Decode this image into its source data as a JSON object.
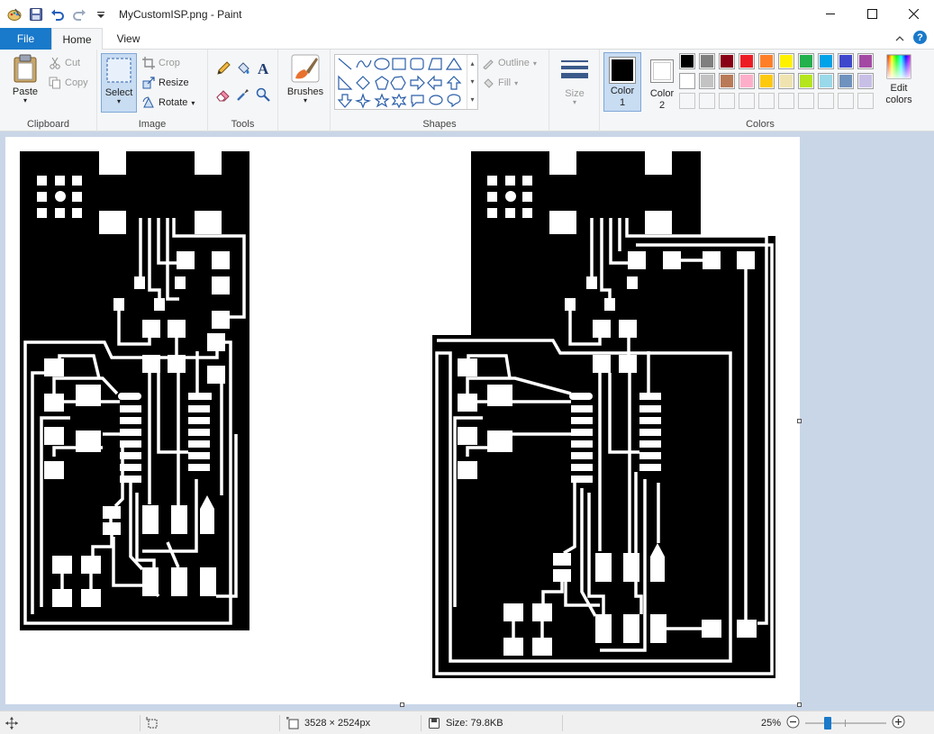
{
  "window": {
    "title": "MyCustomISP.png - Paint"
  },
  "tabs": {
    "file": "File",
    "home": "Home",
    "view": "View"
  },
  "clipboard": {
    "paste": "Paste",
    "cut": "Cut",
    "copy": "Copy",
    "label": "Clipboard"
  },
  "image": {
    "select": "Select",
    "crop": "Crop",
    "resize": "Resize",
    "rotate": "Rotate",
    "label": "Image"
  },
  "tools": {
    "label": "Tools"
  },
  "brushes": {
    "label": "Brushes"
  },
  "shapes": {
    "outline": "Outline",
    "fill": "Fill",
    "label": "Shapes"
  },
  "size": {
    "label": "Size"
  },
  "colors": {
    "color1": "Color",
    "color1_num": "1",
    "color2": "Color",
    "color2_num": "2",
    "edit": "Edit",
    "edit2": "colors",
    "label": "Colors",
    "color1_value": "#000000",
    "color2_value": "#ffffff",
    "palette": [
      "#000000",
      "#7f7f7f",
      "#880015",
      "#ed1c24",
      "#ff7f27",
      "#fff200",
      "#22b14c",
      "#00a2e8",
      "#3f48cc",
      "#a349a4",
      "#ffffff",
      "#c3c3c3",
      "#b97a57",
      "#ffaec9",
      "#ffc90e",
      "#efe4b0",
      "#b5e61d",
      "#99d9ea",
      "#7092be",
      "#c8bfe7",
      "",
      "",
      "",
      "",
      "",
      "",
      "",
      "",
      "",
      ""
    ]
  },
  "status": {
    "dimensions": "3528 × 2524px",
    "size": "Size: 79.8KB",
    "zoom": "25%"
  }
}
